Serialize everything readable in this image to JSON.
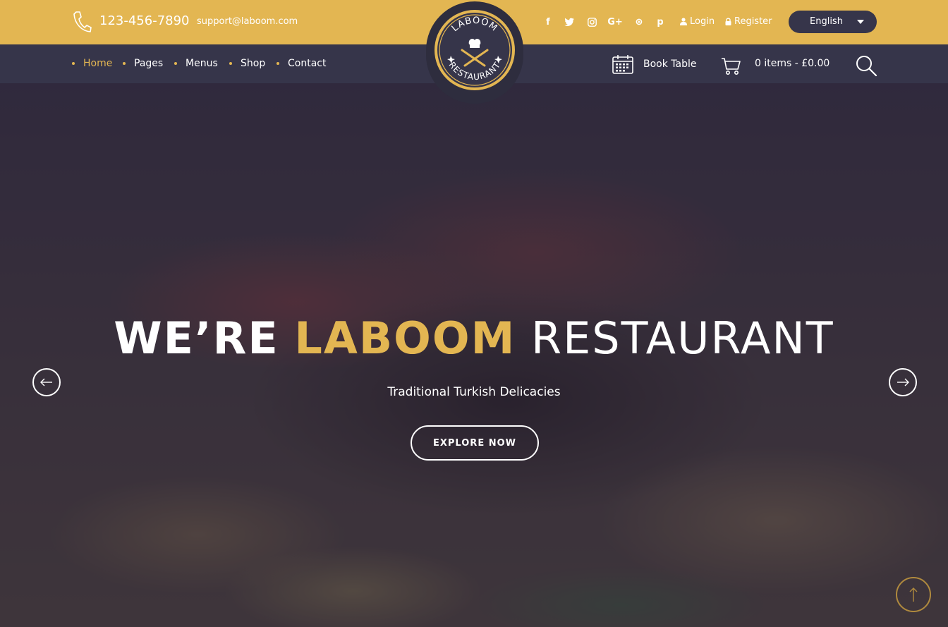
{
  "topbar": {
    "phone": "123-456-7890",
    "email": "support@laboom.com",
    "social": [
      {
        "name": "facebook-icon",
        "glyph": "f"
      },
      {
        "name": "twitter-icon",
        "glyph": "t"
      },
      {
        "name": "instagram-icon",
        "glyph": "◎"
      },
      {
        "name": "google-plus-icon",
        "glyph": "G+"
      },
      {
        "name": "dribbble-icon",
        "glyph": "⊛"
      },
      {
        "name": "pinterest-icon",
        "glyph": "p"
      }
    ],
    "login": "Login",
    "register": "Register",
    "language": "English"
  },
  "logo": {
    "top_text": "LABOOM",
    "bottom_text": "RESTAURANT"
  },
  "nav": {
    "items": [
      {
        "label": "Home",
        "active": true
      },
      {
        "label": "Pages",
        "active": false
      },
      {
        "label": "Menus",
        "active": false
      },
      {
        "label": "Shop",
        "active": false
      },
      {
        "label": "Contact",
        "active": false
      }
    ],
    "book_table": "Book Table",
    "cart": "0 items - £0.00"
  },
  "hero": {
    "title_part1": "WE’RE",
    "title_part2": "LABOOM",
    "title_part3": "RESTAURANT",
    "subtitle": "Traditional Turkish Delicacies",
    "button": "EXPLORE NOW"
  },
  "colors": {
    "accent": "#e3b652",
    "dark": "#36354a"
  }
}
